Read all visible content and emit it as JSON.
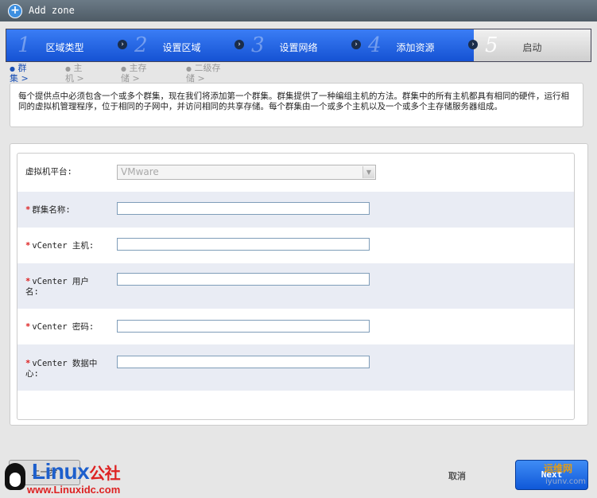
{
  "window": {
    "title": "Add zone"
  },
  "steps": [
    {
      "num": "1",
      "label": "区域类型"
    },
    {
      "num": "2",
      "label": "设置区域"
    },
    {
      "num": "3",
      "label": "设置网络"
    },
    {
      "num": "4",
      "label": "添加资源"
    },
    {
      "num": "5",
      "label": "启动"
    }
  ],
  "substeps": [
    {
      "l1": "群",
      "l2": "集 >"
    },
    {
      "l1": "主",
      "l2": "机 >"
    },
    {
      "l1": "主存",
      "l2": "储 >"
    },
    {
      "l1": "二级存",
      "l2": "储 >"
    }
  ],
  "description": "每个提供点中必须包含一个或多个群集，现在我们将添加第一个群集。群集提供了一种编组主机的方法。群集中的所有主机都具有相同的硬件，运行相同的虚拟机管理程序，位于相同的子网中，并访问相同的共享存储。每个群集由一个或多个主机以及一个或多个主存储服务器组成。",
  "form": {
    "hypervisor": {
      "label": "虚拟机平台:",
      "value": "VMware"
    },
    "fields": [
      {
        "label": "群集名称:",
        "value": ""
      },
      {
        "label": "vCenter 主机:",
        "value": ""
      },
      {
        "label": "vCenter 用户名:",
        "value": ""
      },
      {
        "label": "vCenter 密码:",
        "value": ""
      },
      {
        "label": "vCenter 数据中心:",
        "value": ""
      }
    ],
    "required_mark": "*"
  },
  "buttons": {
    "back": "上一步",
    "cancel": "取消",
    "next": "Next"
  },
  "watermark": {
    "brand": "Linux",
    "brand_cn": "公社",
    "url": "www.Linuxidc.com",
    "wm_top": "运维网",
    "wm_bottom": "iyunv.com"
  }
}
